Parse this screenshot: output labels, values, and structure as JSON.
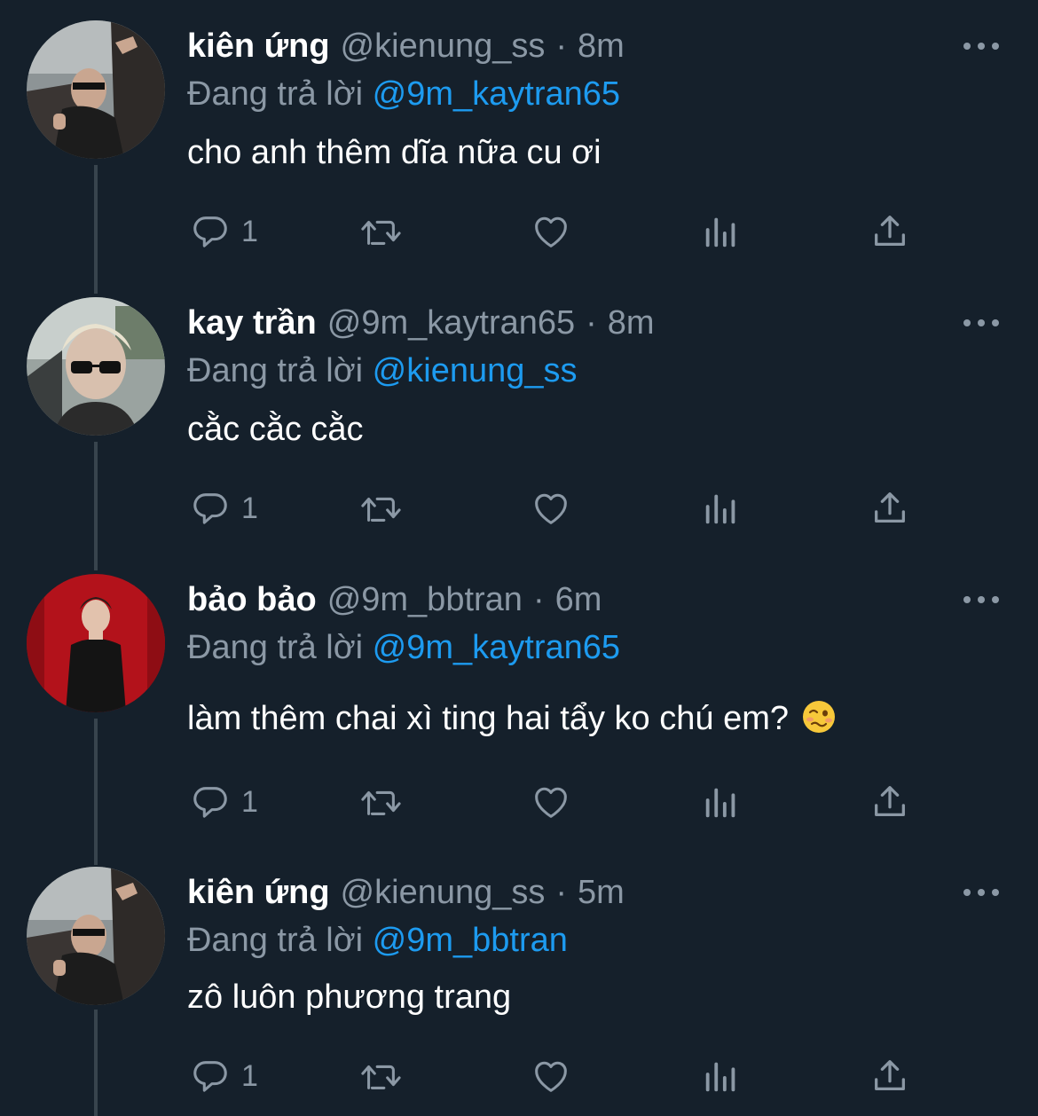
{
  "colors": {
    "background": "#15202b",
    "text_primary": "#ffffff",
    "text_secondary": "#8b98a5",
    "mention": "#1d9bf0",
    "thread_line": "#38444d"
  },
  "reply_prefix": "Đang trả lời",
  "tweets": [
    {
      "name": "kiên ứng",
      "handle": "@kienung_ss",
      "time": "8m",
      "reply_to": "@9m_kaytran65",
      "text": "cho anh thêm dĩa nữa cu ơi",
      "reply_count": "1",
      "avatar": "avatar-kienung"
    },
    {
      "name": "kay trần",
      "handle": "@9m_kaytran65",
      "time": "8m",
      "reply_to": "@kienung_ss",
      "text": "cằc cằc cằc",
      "reply_count": "1",
      "avatar": "avatar-kaytran"
    },
    {
      "name": "bảo bảo",
      "handle": "@9m_bbtran",
      "time": "6m",
      "reply_to": "@9m_kaytran65",
      "text": "làm thêm chai xì ting hai tẩy ko chú em?",
      "emoji": "woozy-face-emoji",
      "reply_count": "1",
      "avatar": "avatar-bbtran"
    },
    {
      "name": "kiên ứng",
      "handle": "@kienung_ss",
      "time": "5m",
      "reply_to": "@9m_bbtran",
      "text": "zô luôn phương trang",
      "reply_count": "1",
      "avatar": "avatar-kienung"
    }
  ],
  "action_icons": [
    "reply-icon",
    "retweet-icon",
    "like-icon",
    "views-icon",
    "share-icon"
  ]
}
